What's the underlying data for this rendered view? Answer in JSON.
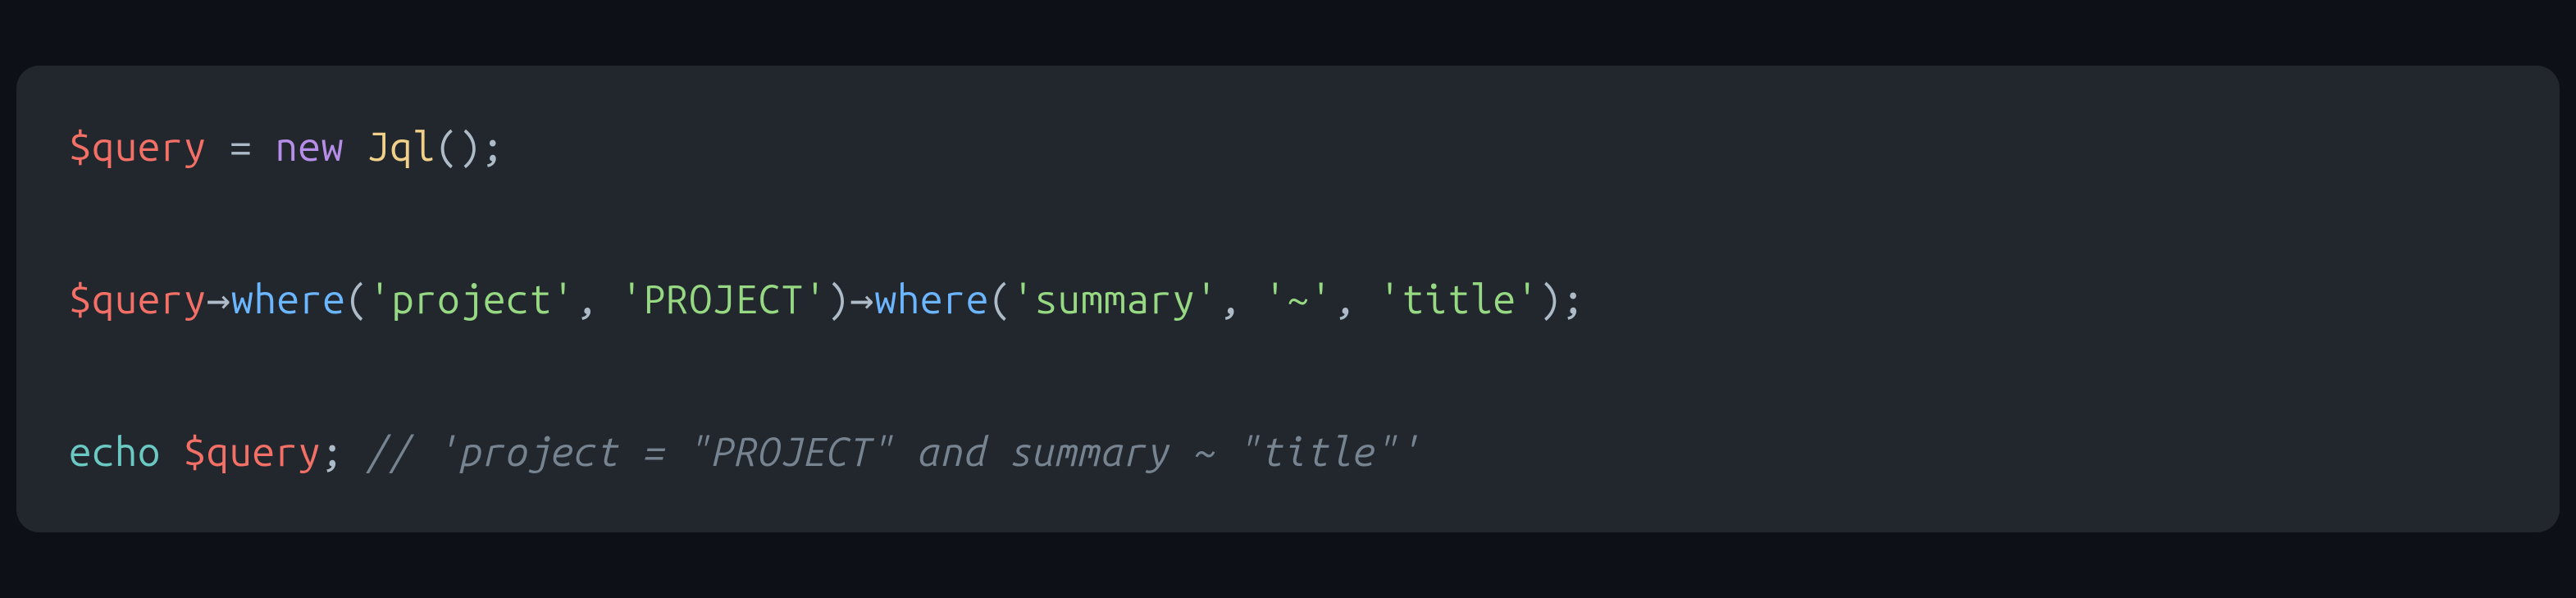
{
  "code": {
    "line1": {
      "var": "$query",
      "assign": " = ",
      "new": "new",
      "sp": " ",
      "class": "Jql",
      "call": "();"
    },
    "line3": {
      "var": "$query",
      "arrow1": "→",
      "method1": "where",
      "open1": "(",
      "arg1": "'project'",
      "comma1": ", ",
      "arg2": "'PROJECT'",
      "close1": ")",
      "arrow2": "→",
      "method2": "where",
      "open2": "(",
      "arg3": "'summary'",
      "comma2": ", ",
      "arg4": "'~'",
      "comma3": ", ",
      "arg5": "'title'",
      "close2": ");"
    },
    "line5": {
      "echo": "echo",
      "sp": " ",
      "var": "$query",
      "semi": "; ",
      "comment": "// 'project = \"PROJECT\" and summary ~ \"title\"'"
    }
  }
}
